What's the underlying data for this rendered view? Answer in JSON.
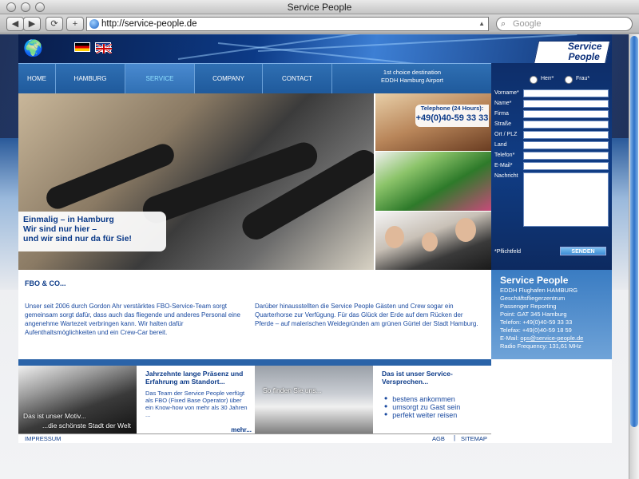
{
  "browser": {
    "window_title": "Service People",
    "url": "http://service-people.de",
    "search_placeholder": "Google",
    "new_tab_label": "+",
    "reload_label": "⟳",
    "back_label": "◀",
    "forward_label": "▶"
  },
  "header": {
    "logo_line1": "Service",
    "logo_line2": "People",
    "flags": [
      "de",
      "en"
    ]
  },
  "nav": {
    "items": [
      {
        "label": "HOME"
      },
      {
        "label": "HAMBURG"
      },
      {
        "label": "SERVICE"
      },
      {
        "label": "COMPANY"
      },
      {
        "label": "CONTACT"
      }
    ],
    "tagline_line1": "1st choice destination",
    "tagline_line2": "EDDH Hamburg Airport"
  },
  "hero": {
    "caption_line1": "Einmalig – in Hamburg",
    "caption_line2": "Wir sind nur hier –",
    "caption_line3": "und wir sind nur da für Sie!"
  },
  "phone": {
    "label": "Telephone (24 Hours):",
    "number": "+49(0)40-59 33 33"
  },
  "form": {
    "radio_herr": "Herr*",
    "radio_frau": "Frau*",
    "fields": [
      "Vorname*",
      "Name*",
      "Firma",
      "Straße",
      "Ort / PLZ",
      "Land",
      "Telefon*",
      "E-Mail*",
      "Nachricht"
    ],
    "required_note": "*Pflichtfeld",
    "submit_label": "SENDEN"
  },
  "content": {
    "title": "FBO & CO...",
    "para1": "Unser seit 2006 durch Gordon Ahr verstärktes FBO-Service-Team sorgt gemeinsam sorgt dafür, dass auch das fliegende und anderes Personal eine angenehme Wartezeit verbringen kann. Wir halten dafür Aufenthaltsmöglichkeiten und ein Crew-Car bereit.",
    "para2": "Darüber hinausstellten die Service People Gästen und Crew sogar ein Quarterhorse zur Verfügung. Für das Glück der Erde auf dem Rücken der Pferde – auf malerischen Weidegründen am grünen Gürtel der Stadt Hamburg."
  },
  "info": {
    "title": "Service People",
    "lines": [
      "EDDH Flughafen HAMBURG",
      "Geschäftsfliegerzentrum",
      "Passenger Reporting",
      "Point: GAT 345 Hamburg",
      "Telefon: +49(0)40-59 33 33",
      "Telefax: +49(0)40-59 18 59"
    ],
    "email_prefix": "E-Mail: ",
    "email": "ops@service-people.de",
    "radio": "Radio Frequency: 131,61 MHz"
  },
  "tiles": {
    "tile1_caption1": "Das ist unser Motiv...",
    "tile1_caption2": "...die schönste Stadt der Welt",
    "tile2_title": "Jahrzehnte lange Präsenz und Erfahrung am Standort...",
    "tile2_body": "Das Team der Service People verfügt als FBO (Fixed Base Operator) über ein Know-how von mehr als 30 Jahren ...",
    "tile2_more": "mehr...",
    "tile3_caption": "So finden Sie uns...",
    "tile4_title": "Das ist unser Service-Versprechen...",
    "tile4_bullets": [
      "bestens ankommen",
      "umsorgt zu Gast sein",
      "perfekt weiter reisen"
    ]
  },
  "footer": {
    "impressum": "IMPRESSUM",
    "agb": "AGB",
    "sitemap": "SITEMAP",
    "separator": "|"
  }
}
